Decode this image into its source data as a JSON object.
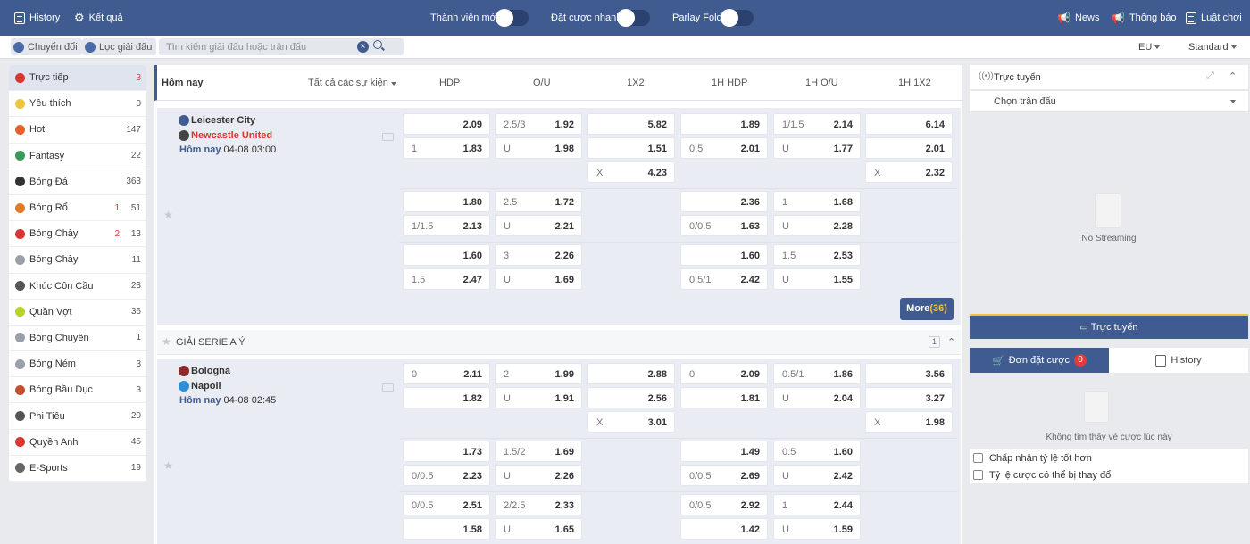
{
  "topbar": {
    "history": "History",
    "results": "Kết quả",
    "toggle_member": "Thành viên mới",
    "toggle_quickbet": "Đặt cược nhanh",
    "toggle_parlay": "Parlay Fold",
    "news": "News",
    "notice": "Thông báo",
    "rules": "Luật chơi"
  },
  "subbar": {
    "convert": "Chuyển đổi",
    "filter": "Lọc giải đấu",
    "search_placeholder": "Tìm kiếm giải đấu hoặc trận đấu",
    "odds_format": "EU",
    "view_mode": "Standard"
  },
  "sidebar": [
    {
      "label": "Trực tiếp",
      "live": "",
      "count": "3",
      "icon": "live-icon",
      "color": "#d9362f"
    },
    {
      "label": "Yêu thích",
      "live": "",
      "count": "0",
      "icon": "star-icon",
      "color": "#f0c33c"
    },
    {
      "label": "Hot",
      "live": "",
      "count": "147",
      "icon": "fire-icon",
      "color": "#e8602c"
    },
    {
      "label": "Fantasy",
      "live": "",
      "count": "22",
      "icon": "fantasy-icon",
      "color": "#3a9a5b"
    },
    {
      "label": "Bóng Đá",
      "live": "",
      "count": "363",
      "icon": "soccer-ball-icon",
      "color": "#333333"
    },
    {
      "label": "Bóng Rổ",
      "live": "1",
      "count": "51",
      "icon": "basketball-icon",
      "color": "#e07b2a"
    },
    {
      "label": "Bóng Chày",
      "live": "2",
      "count": "13",
      "icon": "baseball-icon",
      "color": "#d9362f"
    },
    {
      "label": "Bóng Chày",
      "live": "",
      "count": "11",
      "icon": "softball-icon",
      "color": "#9aa0a8"
    },
    {
      "label": "Khúc Côn Cầu",
      "live": "",
      "count": "23",
      "icon": "hockey-stick-icon",
      "color": "#555555"
    },
    {
      "label": "Quần Vợt",
      "live": "",
      "count": "36",
      "icon": "tennis-ball-icon",
      "color": "#b6d22c"
    },
    {
      "label": "Bóng Chuyền",
      "live": "",
      "count": "1",
      "icon": "volleyball-icon",
      "color": "#9aa0a8"
    },
    {
      "label": "Bóng Ném",
      "live": "",
      "count": "3",
      "icon": "handball-icon",
      "color": "#9aa0a8"
    },
    {
      "label": "Bóng Bầu Dục",
      "live": "",
      "count": "3",
      "icon": "rugby-ball-icon",
      "color": "#c0502f"
    },
    {
      "label": "Phi Tiêu",
      "live": "",
      "count": "20",
      "icon": "dart-icon",
      "color": "#555555"
    },
    {
      "label": "Quyền Anh",
      "live": "",
      "count": "45",
      "icon": "boxing-glove-icon",
      "color": "#d9362f"
    },
    {
      "label": "E-Sports",
      "live": "",
      "count": "19",
      "icon": "gamepad-icon",
      "color": "#666666"
    }
  ],
  "table_header": {
    "period": "Hôm nay",
    "filter": "Tất cả các sự kiện",
    "cols": [
      "HDP",
      "O/U",
      "1X2",
      "1H HDP",
      "1H O/U",
      "1H 1X2"
    ]
  },
  "matches": [
    {
      "home": "Leicester City",
      "away": "Newcastle United",
      "day": "Hôm nay",
      "time": "04-08 03:00",
      "blocks": [
        {
          "hdp": [
            [
              "",
              "2.09"
            ],
            [
              "1",
              "1.83"
            ]
          ],
          "ou": [
            [
              "2.5/3",
              "1.92"
            ],
            [
              "U",
              "1.98"
            ]
          ],
          "x12": [
            [
              "",
              "5.82"
            ],
            [
              "",
              "1.51"
            ],
            [
              "X",
              "4.23"
            ]
          ],
          "h1hdp": [
            [
              "",
              "1.89"
            ],
            [
              "0.5",
              "2.01"
            ]
          ],
          "h1ou": [
            [
              "1/1.5",
              "2.14"
            ],
            [
              "U",
              "1.77"
            ]
          ],
          "h1x12": [
            [
              "",
              "6.14"
            ],
            [
              "",
              "2.01"
            ],
            [
              "X",
              "2.32"
            ]
          ]
        },
        {
          "hdp": [
            [
              "",
              "1.80"
            ],
            [
              "1/1.5",
              "2.13"
            ]
          ],
          "ou": [
            [
              "2.5",
              "1.72"
            ],
            [
              "U",
              "2.21"
            ]
          ],
          "h1hdp": [
            [
              "",
              "2.36"
            ],
            [
              "0/0.5",
              "1.63"
            ]
          ],
          "h1ou": [
            [
              "1",
              "1.68"
            ],
            [
              "U",
              "2.28"
            ]
          ]
        },
        {
          "hdp": [
            [
              "",
              "1.60"
            ],
            [
              "1.5",
              "2.47"
            ]
          ],
          "ou": [
            [
              "3",
              "2.26"
            ],
            [
              "U",
              "1.69"
            ]
          ],
          "h1hdp": [
            [
              "",
              "1.60"
            ],
            [
              "0.5/1",
              "2.42"
            ]
          ],
          "h1ou": [
            [
              "1.5",
              "2.53"
            ],
            [
              "U",
              "1.55"
            ]
          ]
        }
      ],
      "more_label": "More",
      "more_count": "(36)"
    },
    {
      "home": "Bologna",
      "away": "Napoli",
      "day": "Hôm nay",
      "time": "04-08 02:45",
      "blocks": [
        {
          "hdp": [
            [
              "0",
              "2.11"
            ],
            [
              "",
              "1.82"
            ]
          ],
          "ou": [
            [
              "2",
              "1.99"
            ],
            [
              "U",
              "1.91"
            ]
          ],
          "x12": [
            [
              "",
              "2.88"
            ],
            [
              "",
              "2.56"
            ],
            [
              "X",
              "3.01"
            ]
          ],
          "h1hdp": [
            [
              "0",
              "2.09"
            ],
            [
              "",
              "1.81"
            ]
          ],
          "h1ou": [
            [
              "0.5/1",
              "1.86"
            ],
            [
              "U",
              "2.04"
            ]
          ],
          "h1x12": [
            [
              "",
              "3.56"
            ],
            [
              "",
              "3.27"
            ],
            [
              "X",
              "1.98"
            ]
          ]
        },
        {
          "hdp": [
            [
              "",
              "1.73"
            ],
            [
              "0/0.5",
              "2.23"
            ]
          ],
          "ou": [
            [
              "1.5/2",
              "1.69"
            ],
            [
              "U",
              "2.26"
            ]
          ],
          "h1hdp": [
            [
              "",
              "1.49"
            ],
            [
              "0/0.5",
              "2.69"
            ]
          ],
          "h1ou": [
            [
              "0.5",
              "1.60"
            ],
            [
              "U",
              "2.42"
            ]
          ]
        },
        {
          "hdp": [
            [
              "0/0.5",
              "2.51"
            ],
            [
              "",
              "1.58"
            ]
          ],
          "ou": [
            [
              "2/2.5",
              "2.33"
            ],
            [
              "U",
              "1.65"
            ]
          ],
          "h1hdp": [
            [
              "0/0.5",
              "2.92"
            ],
            [
              "",
              "1.42"
            ]
          ],
          "h1ou": [
            [
              "1",
              "2.44"
            ],
            [
              "U",
              "1.59"
            ]
          ]
        }
      ]
    }
  ],
  "league": {
    "name": "GIẢI SERIE A Ý",
    "count": "1"
  },
  "stream": {
    "title": "Trực tuyến",
    "select": "Chọn trận đấu",
    "empty": "No Streaming",
    "button": "Trực tuyến"
  },
  "betslip": {
    "tab": "Đơn đặt cược",
    "tab_count": "0",
    "history_tab": "History",
    "empty": "Không tìm thấy vé cược lúc này",
    "opt1": "Chấp nhận tỷ lệ tốt hơn",
    "opt2": "Tỷ lệ cược có thể bị thay đổi"
  },
  "colors": {
    "brand": "#3f5b8f",
    "accent": "#f0c33c",
    "live": "#e23b3b"
  }
}
